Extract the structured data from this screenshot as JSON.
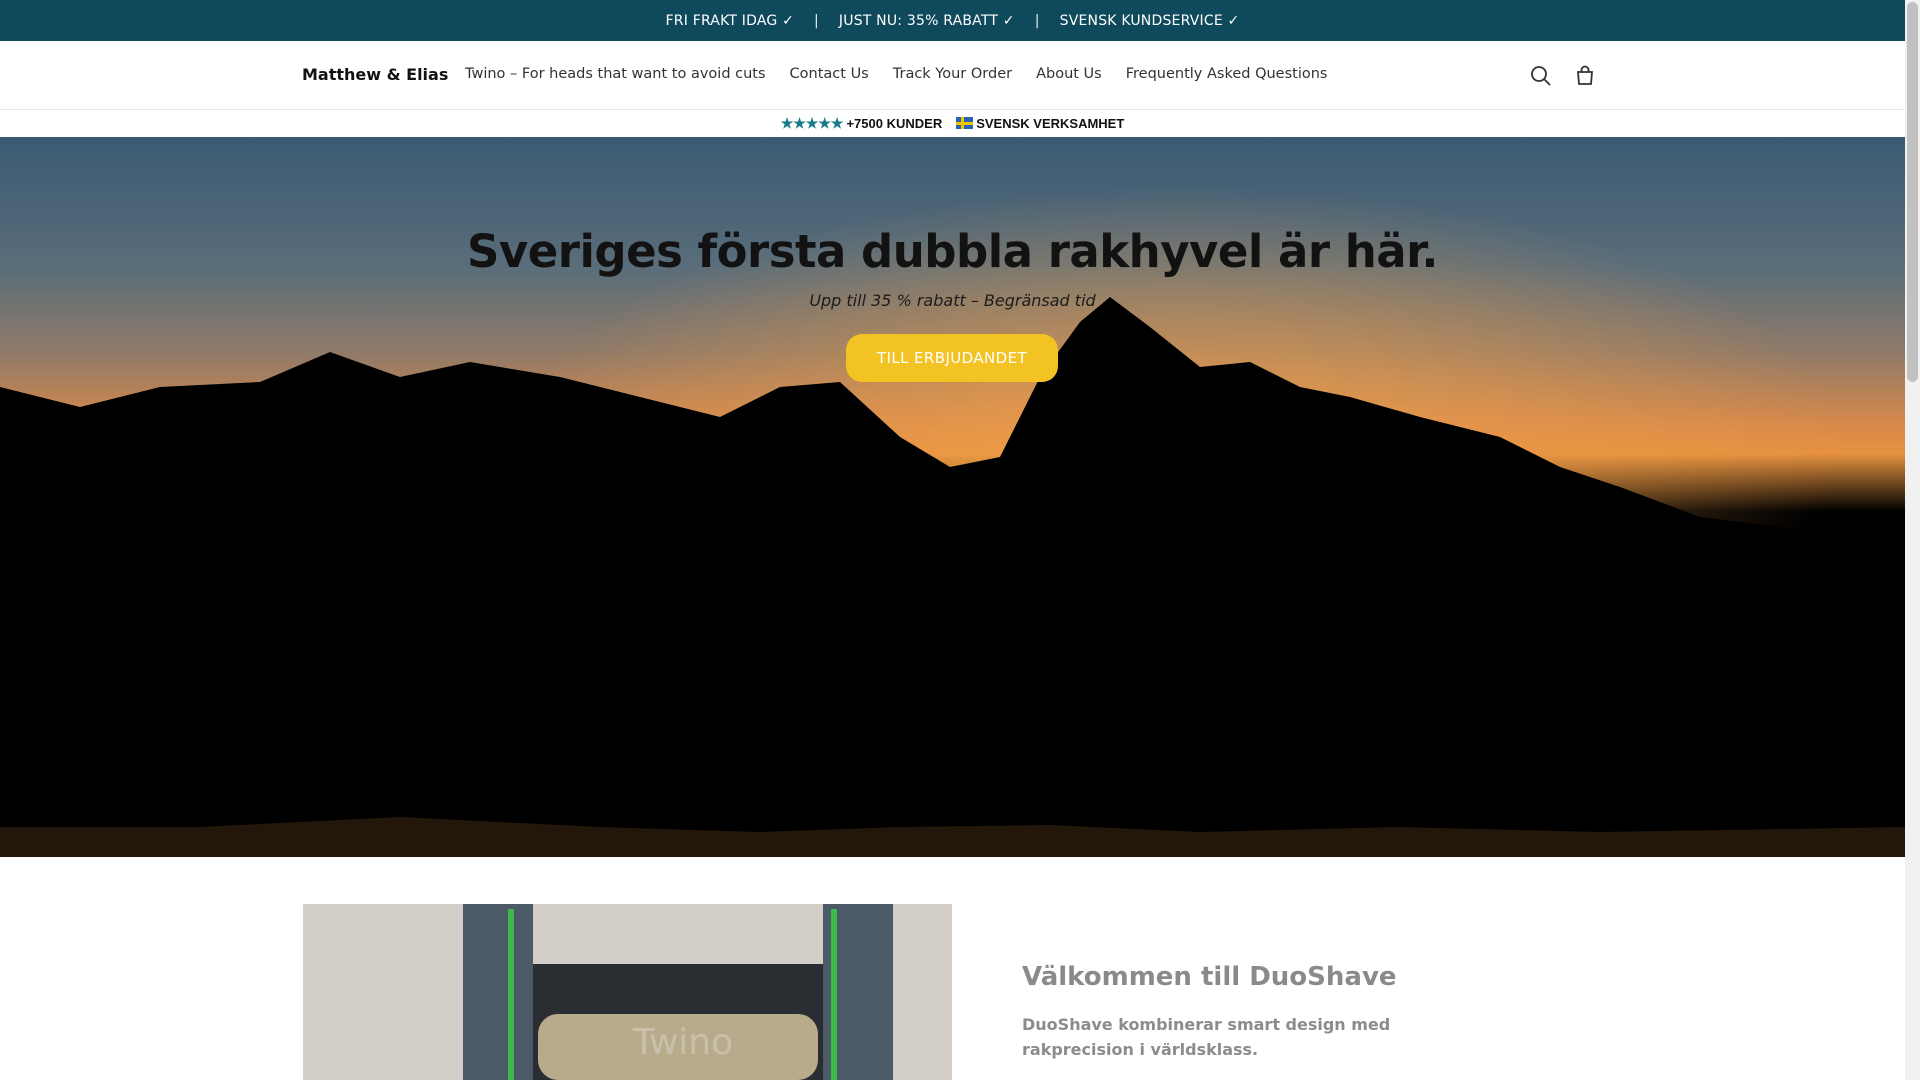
{
  "announcement": {
    "items": [
      "FRI FRAKT IDAG ✓",
      "JUST NU: 35% RABATT ✓",
      "SVENSK KUNDSERVICE ✓"
    ],
    "separator": "|"
  },
  "header": {
    "logo": "Matthew & Elias",
    "nav": [
      "Twino – For heads that want to avoid cuts",
      "Contact Us",
      "Track Your Order",
      "About Us",
      "Frequently Asked Questions"
    ]
  },
  "trust": {
    "stars": "★★★★★",
    "customers": "+7500 KUNDER",
    "company": "SVENSK VERKSAMHET"
  },
  "hero": {
    "title": "Sveriges första dubbla rakhyvel är här.",
    "subtitle": "Upp till 35 % rabatt – Begränsad tid",
    "button": "TILL ERBJUDANDET"
  },
  "welcome": {
    "product_label": "Twino",
    "title": "Välkommen till DuoShave",
    "text": "DuoShave kombinerar smart design med rakprecision i världsklass."
  },
  "colors": {
    "announcement_bg": "#0f4a5c",
    "button_bg": "#f3c324",
    "star": "#1a7a8a"
  }
}
